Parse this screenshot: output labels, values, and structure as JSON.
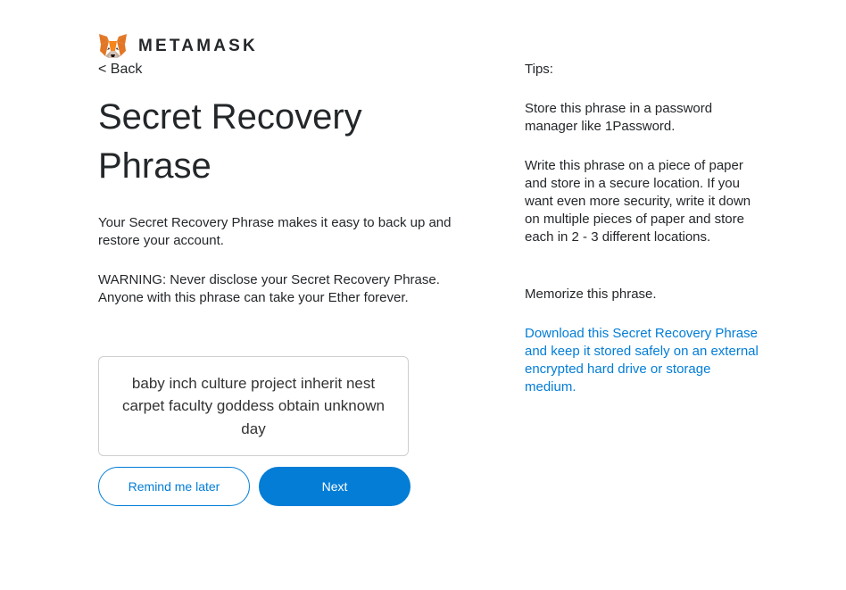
{
  "brand": {
    "name": "METAMASK",
    "logo_icon": "metamask-fox-icon"
  },
  "nav": {
    "back_label": "< Back"
  },
  "page": {
    "title": "Secret Recovery Phrase",
    "description": "Your Secret Recovery Phrase makes it easy to back up and restore your account.",
    "warning": "WARNING: Never disclose your Secret Recovery Phrase. Anyone with this phrase can take your Ether forever."
  },
  "phrase": {
    "text": "baby inch culture project inherit nest carpet faculty goddess obtain unknown day"
  },
  "buttons": {
    "remind_label": "Remind me later",
    "next_label": "Next"
  },
  "tips": {
    "heading": "Tips:",
    "items": [
      "Store this phrase in a password manager like 1Password.",
      "Write this phrase on a piece of paper and store in a secure location. If you want even more security, write it down on multiple pieces of paper and store each in 2 - 3 different locations.",
      "Memorize this phrase."
    ],
    "download_link": "Download this Secret Recovery Phrase and keep it stored safely on an external encrypted hard drive or storage medium."
  },
  "colors": {
    "accent": "#037dd6",
    "text": "#24272a",
    "fox_orange": "#e2761b"
  }
}
